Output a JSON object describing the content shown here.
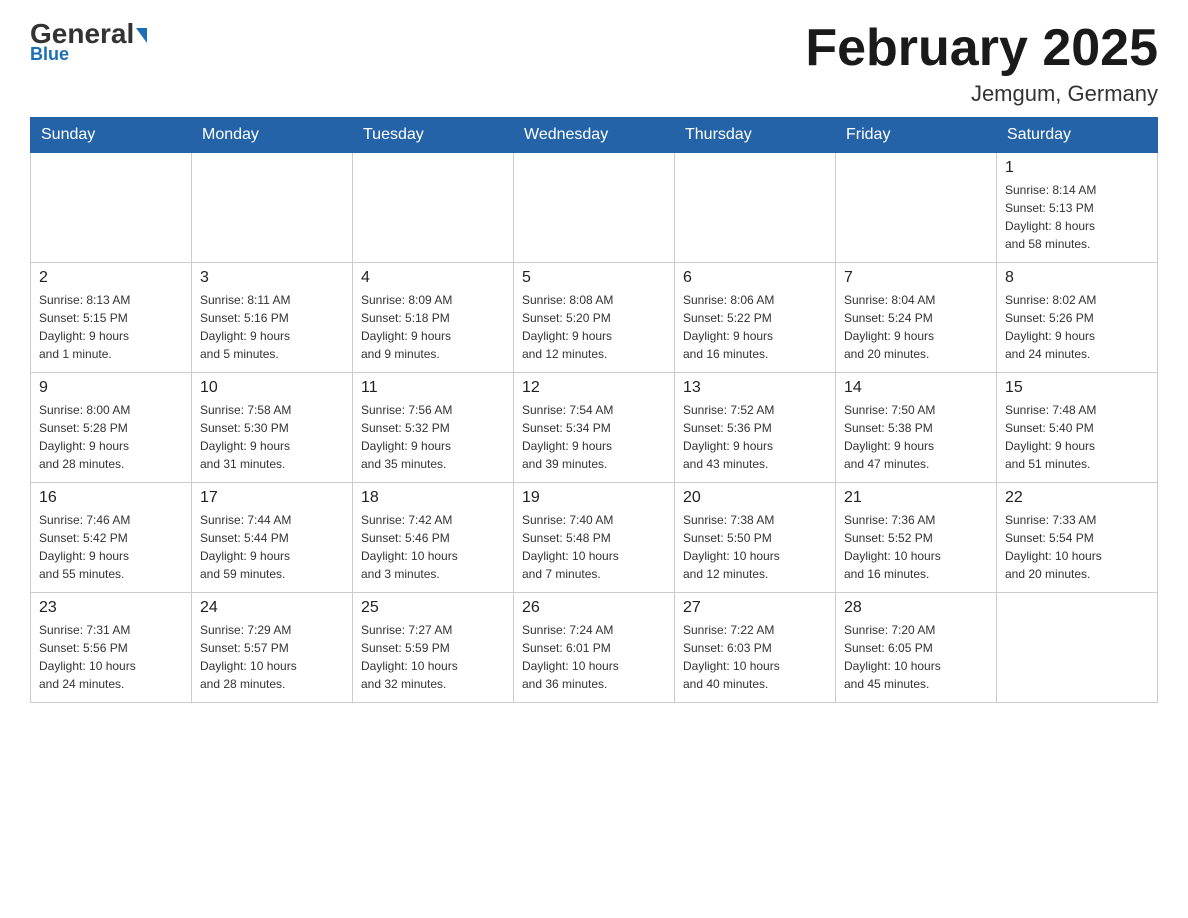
{
  "header": {
    "logo_main": "General",
    "logo_sub": "Blue",
    "title": "February 2025",
    "location": "Jemgum, Germany"
  },
  "days_of_week": [
    "Sunday",
    "Monday",
    "Tuesday",
    "Wednesday",
    "Thursday",
    "Friday",
    "Saturday"
  ],
  "weeks": [
    [
      {
        "day": "",
        "info": ""
      },
      {
        "day": "",
        "info": ""
      },
      {
        "day": "",
        "info": ""
      },
      {
        "day": "",
        "info": ""
      },
      {
        "day": "",
        "info": ""
      },
      {
        "day": "",
        "info": ""
      },
      {
        "day": "1",
        "info": "Sunrise: 8:14 AM\nSunset: 5:13 PM\nDaylight: 8 hours\nand 58 minutes."
      }
    ],
    [
      {
        "day": "2",
        "info": "Sunrise: 8:13 AM\nSunset: 5:15 PM\nDaylight: 9 hours\nand 1 minute."
      },
      {
        "day": "3",
        "info": "Sunrise: 8:11 AM\nSunset: 5:16 PM\nDaylight: 9 hours\nand 5 minutes."
      },
      {
        "day": "4",
        "info": "Sunrise: 8:09 AM\nSunset: 5:18 PM\nDaylight: 9 hours\nand 9 minutes."
      },
      {
        "day": "5",
        "info": "Sunrise: 8:08 AM\nSunset: 5:20 PM\nDaylight: 9 hours\nand 12 minutes."
      },
      {
        "day": "6",
        "info": "Sunrise: 8:06 AM\nSunset: 5:22 PM\nDaylight: 9 hours\nand 16 minutes."
      },
      {
        "day": "7",
        "info": "Sunrise: 8:04 AM\nSunset: 5:24 PM\nDaylight: 9 hours\nand 20 minutes."
      },
      {
        "day": "8",
        "info": "Sunrise: 8:02 AM\nSunset: 5:26 PM\nDaylight: 9 hours\nand 24 minutes."
      }
    ],
    [
      {
        "day": "9",
        "info": "Sunrise: 8:00 AM\nSunset: 5:28 PM\nDaylight: 9 hours\nand 28 minutes."
      },
      {
        "day": "10",
        "info": "Sunrise: 7:58 AM\nSunset: 5:30 PM\nDaylight: 9 hours\nand 31 minutes."
      },
      {
        "day": "11",
        "info": "Sunrise: 7:56 AM\nSunset: 5:32 PM\nDaylight: 9 hours\nand 35 minutes."
      },
      {
        "day": "12",
        "info": "Sunrise: 7:54 AM\nSunset: 5:34 PM\nDaylight: 9 hours\nand 39 minutes."
      },
      {
        "day": "13",
        "info": "Sunrise: 7:52 AM\nSunset: 5:36 PM\nDaylight: 9 hours\nand 43 minutes."
      },
      {
        "day": "14",
        "info": "Sunrise: 7:50 AM\nSunset: 5:38 PM\nDaylight: 9 hours\nand 47 minutes."
      },
      {
        "day": "15",
        "info": "Sunrise: 7:48 AM\nSunset: 5:40 PM\nDaylight: 9 hours\nand 51 minutes."
      }
    ],
    [
      {
        "day": "16",
        "info": "Sunrise: 7:46 AM\nSunset: 5:42 PM\nDaylight: 9 hours\nand 55 minutes."
      },
      {
        "day": "17",
        "info": "Sunrise: 7:44 AM\nSunset: 5:44 PM\nDaylight: 9 hours\nand 59 minutes."
      },
      {
        "day": "18",
        "info": "Sunrise: 7:42 AM\nSunset: 5:46 PM\nDaylight: 10 hours\nand 3 minutes."
      },
      {
        "day": "19",
        "info": "Sunrise: 7:40 AM\nSunset: 5:48 PM\nDaylight: 10 hours\nand 7 minutes."
      },
      {
        "day": "20",
        "info": "Sunrise: 7:38 AM\nSunset: 5:50 PM\nDaylight: 10 hours\nand 12 minutes."
      },
      {
        "day": "21",
        "info": "Sunrise: 7:36 AM\nSunset: 5:52 PM\nDaylight: 10 hours\nand 16 minutes."
      },
      {
        "day": "22",
        "info": "Sunrise: 7:33 AM\nSunset: 5:54 PM\nDaylight: 10 hours\nand 20 minutes."
      }
    ],
    [
      {
        "day": "23",
        "info": "Sunrise: 7:31 AM\nSunset: 5:56 PM\nDaylight: 10 hours\nand 24 minutes."
      },
      {
        "day": "24",
        "info": "Sunrise: 7:29 AM\nSunset: 5:57 PM\nDaylight: 10 hours\nand 28 minutes."
      },
      {
        "day": "25",
        "info": "Sunrise: 7:27 AM\nSunset: 5:59 PM\nDaylight: 10 hours\nand 32 minutes."
      },
      {
        "day": "26",
        "info": "Sunrise: 7:24 AM\nSunset: 6:01 PM\nDaylight: 10 hours\nand 36 minutes."
      },
      {
        "day": "27",
        "info": "Sunrise: 7:22 AM\nSunset: 6:03 PM\nDaylight: 10 hours\nand 40 minutes."
      },
      {
        "day": "28",
        "info": "Sunrise: 7:20 AM\nSunset: 6:05 PM\nDaylight: 10 hours\nand 45 minutes."
      },
      {
        "day": "",
        "info": ""
      }
    ]
  ]
}
